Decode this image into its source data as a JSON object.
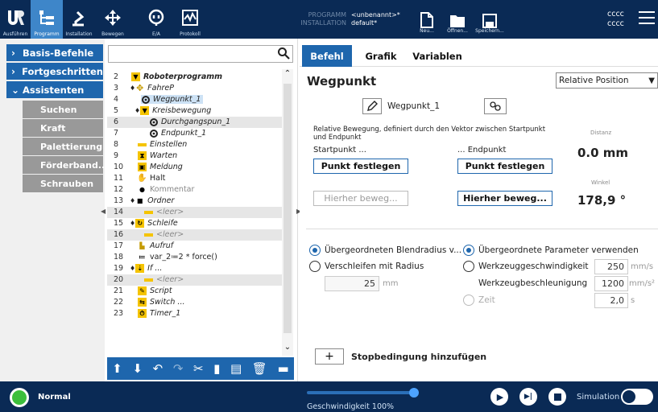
{
  "topnav": {
    "run": "Ausführen",
    "program": "Programm",
    "installation": "Installation",
    "move": "Bewegen",
    "io": "E/A",
    "log": "Protokoll"
  },
  "program_info": {
    "program_label": "PROGRAMM",
    "program_name": "<unbenannt>*",
    "installation_label": "INSTALLATION",
    "installation_name": "default*"
  },
  "file_buttons": {
    "new": "Neu...",
    "open": "Öffnen...",
    "save": "Speichern..."
  },
  "user": {
    "line1": "cccc",
    "line2": "cccc"
  },
  "left_menu": {
    "basic": "Basis-Befehle",
    "advanced": "Fortgeschritten",
    "wizards": "Assistenten",
    "items": [
      "Suchen",
      "Kraft",
      "Palettierung",
      "Förderband...",
      "Schrauben"
    ]
  },
  "tree": {
    "search_placeholder": "",
    "rows": [
      {
        "num": "2",
        "label": "Roboterprogramm"
      },
      {
        "num": "3",
        "label": "FahreP"
      },
      {
        "num": "4",
        "label": "Wegpunkt_1"
      },
      {
        "num": "5",
        "label": "Kreisbewegung"
      },
      {
        "num": "6",
        "label": "Durchgangspun_1"
      },
      {
        "num": "7",
        "label": "Endpunkt_1"
      },
      {
        "num": "8",
        "label": "Einstellen"
      },
      {
        "num": "9",
        "label": "Warten"
      },
      {
        "num": "10",
        "label": "Meldung"
      },
      {
        "num": "11",
        "label": "Halt"
      },
      {
        "num": "12",
        "label": "Kommentar"
      },
      {
        "num": "13",
        "label": "Ordner"
      },
      {
        "num": "14",
        "label": "<leer>"
      },
      {
        "num": "15",
        "label": "Schleife"
      },
      {
        "num": "16",
        "label": "<leer>"
      },
      {
        "num": "17",
        "label": "Aufruf"
      },
      {
        "num": "18",
        "label": "var_2≔2 * force()"
      },
      {
        "num": "19",
        "label": "If ..."
      },
      {
        "num": "20",
        "label": "<leer>"
      },
      {
        "num": "21",
        "label": "Script"
      },
      {
        "num": "22",
        "label": "Switch ..."
      },
      {
        "num": "23",
        "label": "Timer_1"
      }
    ]
  },
  "tabs": [
    "Befehl",
    "Grafik",
    "Variablen"
  ],
  "panel": {
    "title": "Wegpunkt",
    "mode": "Relative Position",
    "waypoint_name": "Wegpunkt_1",
    "description": "Relative Bewegung, definiert durch den Vektor zwischen Startpunkt und Endpunkt",
    "start_label": "Startpunkt ...",
    "end_label": "... Endpunkt",
    "set_point": "Punkt festlegen",
    "move_here": "Hierher beweg...",
    "distance_label": "Distanz",
    "distance_value": "0.0 mm",
    "angle_label": "Winkel",
    "angle_value": "178,9 °",
    "blend_parent": "Übergeordneten Blendradius v...",
    "blend_radius": "Verschleifen mit Radius",
    "blend_value": "25",
    "blend_unit": "mm",
    "params_parent": "Übergeordnete Parameter verwenden",
    "tool_speed": "Werkzeuggeschwindigkeit",
    "tool_speed_value": "250",
    "tool_speed_unit": "mm/s",
    "tool_accel": "Werkzeugbeschleunigung",
    "tool_accel_value": "1200",
    "tool_accel_unit": "mm/s²",
    "time": "Zeit",
    "time_value": "2,0",
    "time_unit": "s",
    "add_stop": "Stopbedingung hinzufügen"
  },
  "bottom": {
    "status": "Normal",
    "speed_label": "Geschwindigkeit 100%",
    "speed_value": 100,
    "simulation": "Simulation"
  },
  "colors": {
    "navy": "#0a2a55",
    "accent": "#1e66ad",
    "status_green": "#3cbf3c"
  }
}
